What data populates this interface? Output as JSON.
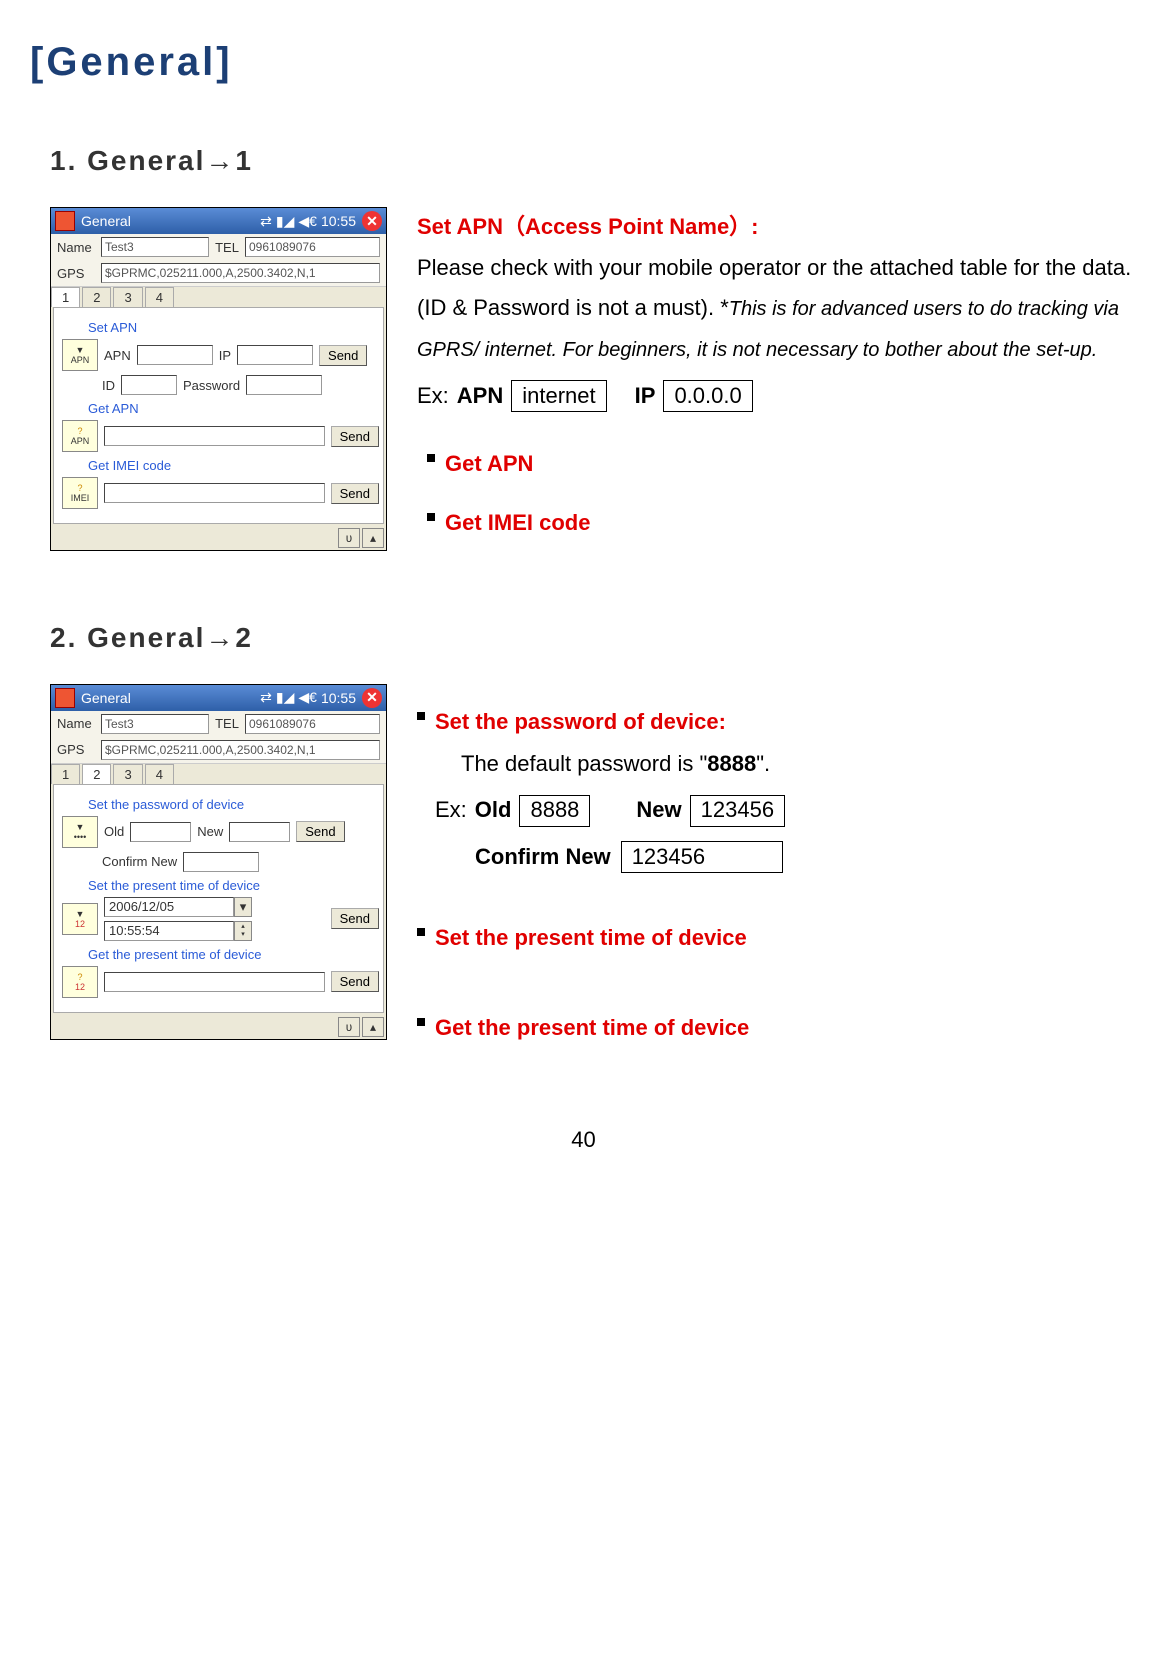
{
  "page": {
    "title": "[General]",
    "section1_heading": "1. General→1",
    "section2_heading": "2. General→2",
    "page_number": "40"
  },
  "screenshot_common": {
    "titlebar_text": "General",
    "time_text": "10:55",
    "name_label": "Name",
    "name_value": "Test3",
    "tel_label": "TEL",
    "tel_value": "0961089076",
    "gps_label": "GPS",
    "gps_value": "$GPRMC,025211.000,A,2500.3402,N,1",
    "tab1": "1",
    "tab2": "2",
    "tab3": "3",
    "tab4": "4",
    "send_button": "Send"
  },
  "screenshot1": {
    "group_set_apn": "Set APN",
    "apn_badge": "APN",
    "label_apn": "APN",
    "label_ip": "IP",
    "label_id": "ID",
    "label_password": "Password",
    "group_get_apn": "Get APN",
    "group_get_imei": "Get IMEI code",
    "imei_badge": "IMEI"
  },
  "screenshot2": {
    "group_set_pw": "Set the password of device",
    "label_old": "Old",
    "label_new": "New",
    "label_confirm_new": "Confirm New",
    "group_set_time": "Set the present time of device",
    "date_value": "2006/12/05",
    "time_value": "10:55:54",
    "group_get_time": "Get the present time of device"
  },
  "desc1": {
    "set_apn_title": "Set APN（Access Point Name）:",
    "body_line": "Please check with your mobile operator or the attached table for the data. (ID & Password is not a must). ",
    "note_prefix": "*",
    "note_body": "This is for advanced users to do tracking via GPRS/ internet. For beginners, it is not necessary to bother about the set-up.",
    "ex_prefix": "Ex: ",
    "apn_label": "APN",
    "apn_value": "internet",
    "ip_label": "IP",
    "ip_value": "0.0.0.0",
    "bullet_get_apn": "Get APN",
    "bullet_get_imei": "Get IMEI code"
  },
  "desc2": {
    "bullet_set_pw": "Set the password of device:",
    "default_line_pre": "The default password is \"",
    "default_pw": "8888",
    "default_line_post": "\".",
    "ex_prefix": "Ex: ",
    "old_label": "Old",
    "old_value": "8888",
    "new_label": "New",
    "new_value": "123456",
    "confirm_label": "Confirm New",
    "confirm_value": "123456",
    "bullet_set_time": "Set the present time of device",
    "bullet_get_time": "Get the present time of device"
  }
}
